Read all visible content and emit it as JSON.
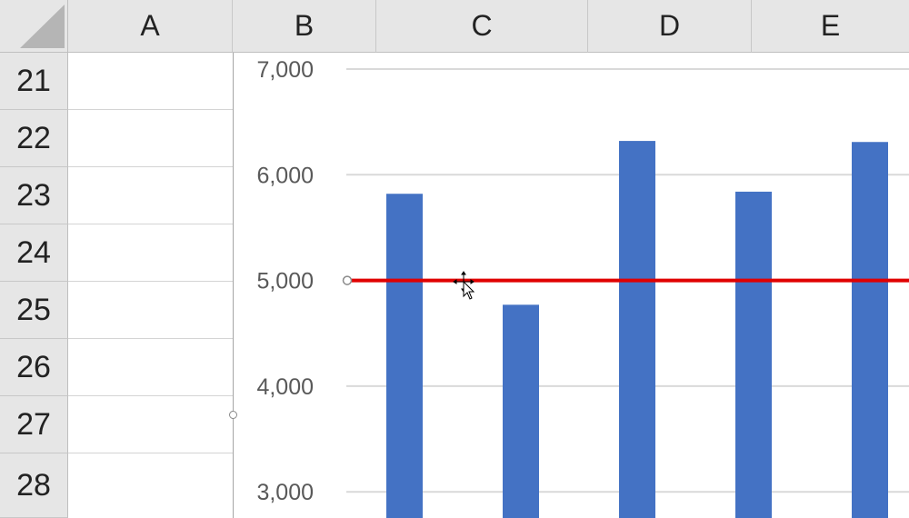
{
  "columns": [
    "A",
    "B",
    "C",
    "D",
    "E"
  ],
  "rows": [
    "21",
    "22",
    "23",
    "24",
    "25",
    "26",
    "27",
    "28"
  ],
  "chart_data": {
    "type": "bar",
    "categories": [
      "",
      "",
      "",
      "",
      ""
    ],
    "series": [
      {
        "values": [
          5820,
          4770,
          6320,
          5840,
          6310
        ],
        "color": "#4472C4"
      }
    ],
    "target_line": {
      "value": 5000,
      "color": "#E00000"
    },
    "ylim": [
      2740,
      7100
    ],
    "yticks": [
      3000,
      4000,
      5000,
      6000,
      7000
    ],
    "ytick_labels": [
      "3,000",
      "4,000",
      "5,000",
      "6,000",
      "7,000"
    ],
    "grid": true
  }
}
